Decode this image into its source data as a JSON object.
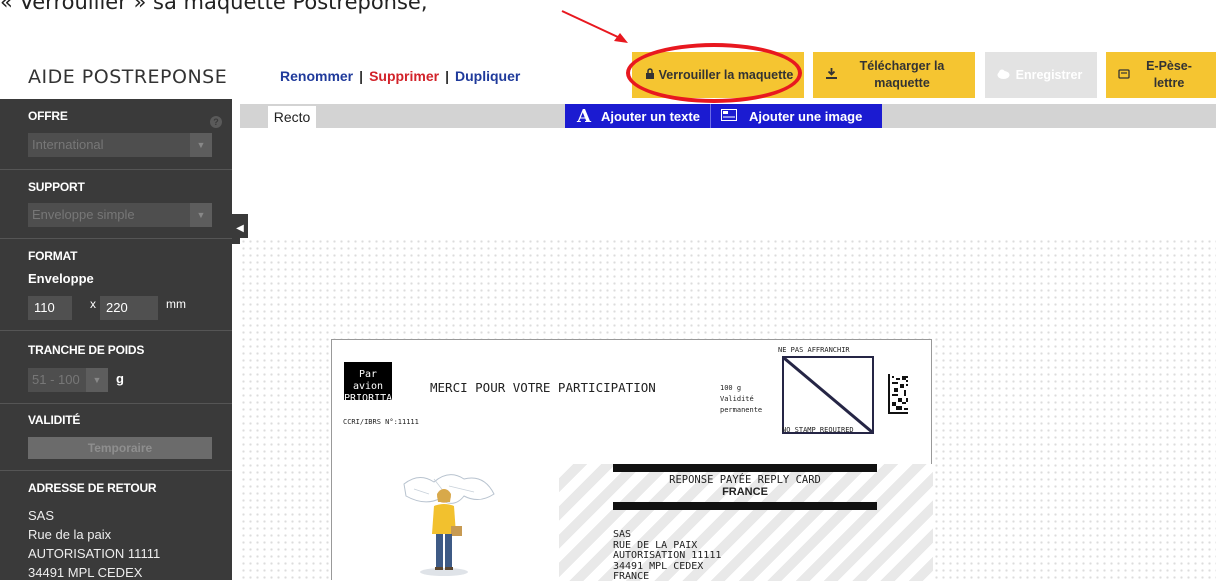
{
  "caption": "« Verrouiller » sa maquette Postréponse,",
  "header": {
    "app_title": "AIDE POSTREPONSE",
    "rename": "Renommer",
    "delete": "Supprimer",
    "duplicate": "Dupliquer",
    "sep": "|"
  },
  "toolbar": {
    "lock_label": "Verrouiller la maquette",
    "download_label": "Télécharger la maquette",
    "save_label": "Enregistrer",
    "epese_label": "E-Pèse-lettre"
  },
  "sidebar": {
    "offre_title": "OFFRE",
    "offre_value": "International",
    "support_title": "SUPPORT",
    "support_value": "Enveloppe simple",
    "format_title": "FORMAT",
    "format_sub": "Enveloppe",
    "format_h": "110",
    "format_x": "x",
    "format_w": "220",
    "format_unit": "mm",
    "poids_title": "TRANCHE DE POIDS",
    "poids_value": "51 - 100",
    "poids_unit": "g",
    "validite_title": "VALIDITÉ",
    "validite_value": "Temporaire",
    "adresse_title": "ADRESSE DE RETOUR",
    "adresse_lines": [
      "SAS",
      "Rue de la paix",
      "AUTORISATION 11111",
      "34491 MPL CEDEX"
    ]
  },
  "tabs": {
    "recto": "Recto",
    "add_text": "Ajouter un texte",
    "add_image": "Ajouter une image"
  },
  "card": {
    "par_avion": "Par avion",
    "prioritaire": "PRIORITAIRE",
    "merci": "MERCI POUR VOTRE PARTICIPATION",
    "ccri": "CCRI/IBRS N°:11111",
    "weight": "100 g",
    "validite1": "Validité",
    "validite2": "permanente",
    "ne_pas": "NE PAS AFFRANCHIR",
    "no_stamp": "NO STAMP REQUIRED",
    "reponse": "REPONSE PAYÉE REPLY CARD",
    "france_bold": "FRANCE",
    "addr_lines": [
      "SAS",
      "RUE DE LA PAIX",
      "AUTORISATION 11111",
      "34491 MPL CEDEX",
      "FRANCE"
    ]
  },
  "colors": {
    "accent_yellow": "#f5c531",
    "sidebar_bg": "#3a3a3a",
    "highlight_red": "#e8181f",
    "add_bar_blue": "#1b1bd1",
    "link_blue": "#1f3a9b",
    "delete_red": "#d2232a"
  },
  "icons": {
    "lock": "lock-icon",
    "download": "download-icon",
    "cloud": "cloud-upload-icon",
    "scale": "scale-icon",
    "help": "help-icon",
    "text": "text-icon",
    "image": "image-icon",
    "collapse": "chevron-left-icon"
  }
}
